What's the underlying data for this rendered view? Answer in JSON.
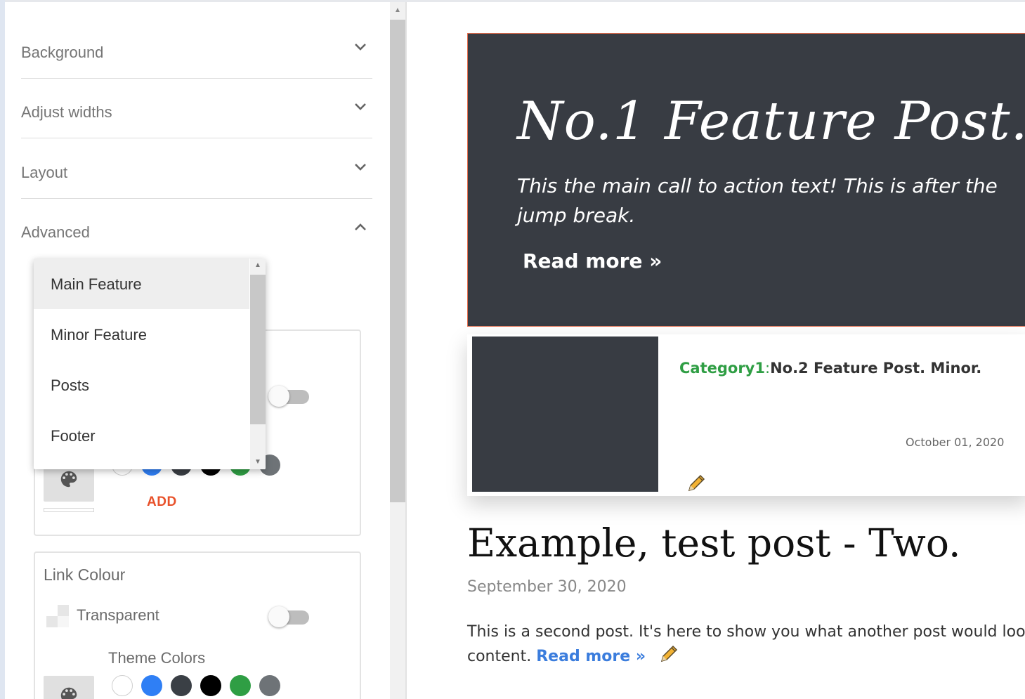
{
  "accordion": [
    {
      "label": "Background",
      "expanded": false
    },
    {
      "label": "Adjust widths",
      "expanded": false
    },
    {
      "label": "Layout",
      "expanded": false
    },
    {
      "label": "Advanced",
      "expanded": true
    }
  ],
  "dropdown": {
    "selected": "Main Feature",
    "options": [
      "Main Feature",
      "Minor Feature",
      "Posts",
      "Footer"
    ]
  },
  "colour_card": {
    "add_label": "ADD",
    "toggle_on": false
  },
  "link_colour": {
    "title": "Link Colour",
    "transparent_label": "Transparent",
    "toggle_on": false,
    "theme_colors_label": "Theme Colors"
  },
  "theme_colors": [
    "#ffffff",
    "#2f7ff5",
    "#3a3f45",
    "#000000",
    "#2f9e44",
    "#6e7377"
  ],
  "preview": {
    "hero": {
      "title": "No.1 Feature Post.",
      "text": "This the main call to action text! This is after the jump break.",
      "link": "Read more »"
    },
    "minor": {
      "category": "Category1",
      "separator": ":",
      "title": "No.2 Feature Post. Minor.",
      "date": "October 01, 2020"
    },
    "post": {
      "title": "Example, test post - Two.",
      "date": "September 30, 2020",
      "body": "This is a second post. It's here to show you what another post would look",
      "body_line2": "content.",
      "link": "Read more »"
    }
  },
  "colors": {
    "accent_orange": "#e8512a",
    "category_green": "#2f9e44",
    "link_blue": "#3b7ddd",
    "hero_bg": "#383c43"
  }
}
